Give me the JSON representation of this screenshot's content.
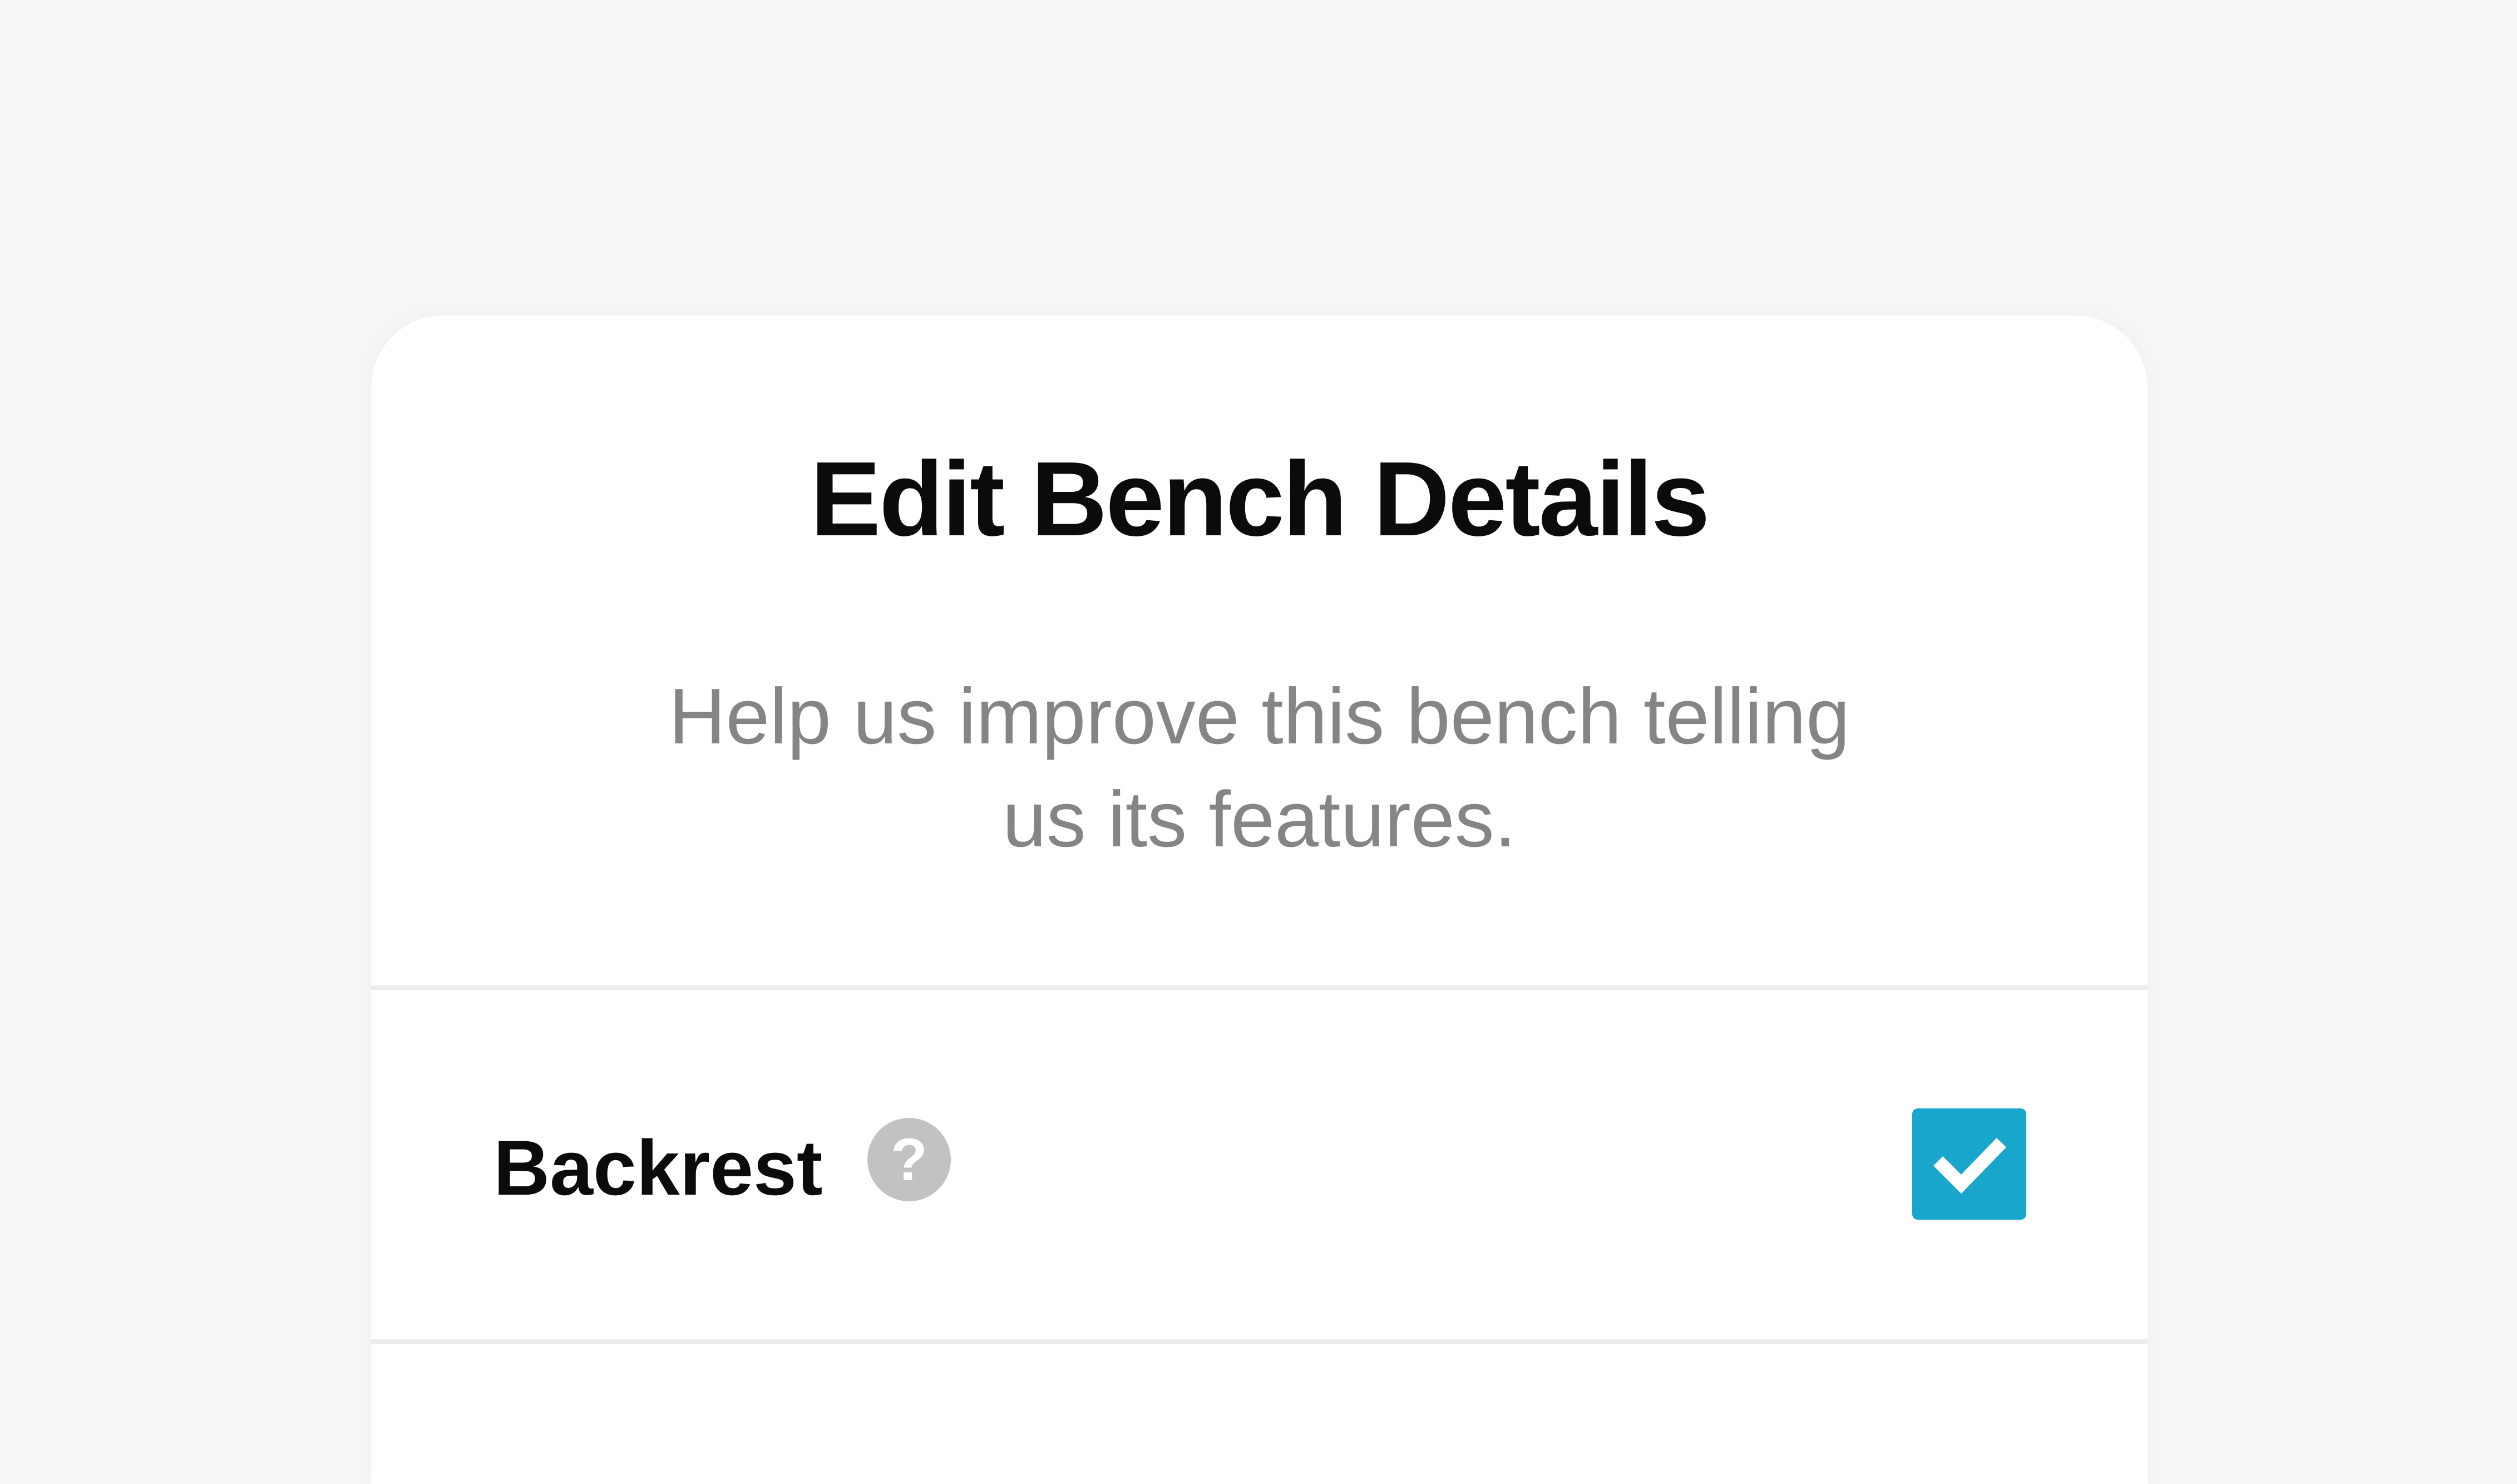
{
  "dialog": {
    "title": "Edit Bench Details",
    "subtitle": "Help us improve this bench telling us its features."
  },
  "features": [
    {
      "label": "Backrest",
      "help_icon": "question-mark-icon",
      "help_glyph": "?",
      "checked": true,
      "check_icon": "checkmark-icon"
    }
  ],
  "colors": {
    "background": "#f6f6f6",
    "card": "#ffffff",
    "title": "#0b0b0b",
    "subtitle": "#858585",
    "help_icon": "#c2c2c2",
    "checkbox_accent": "#19a6cc",
    "divider": "#ececec"
  }
}
